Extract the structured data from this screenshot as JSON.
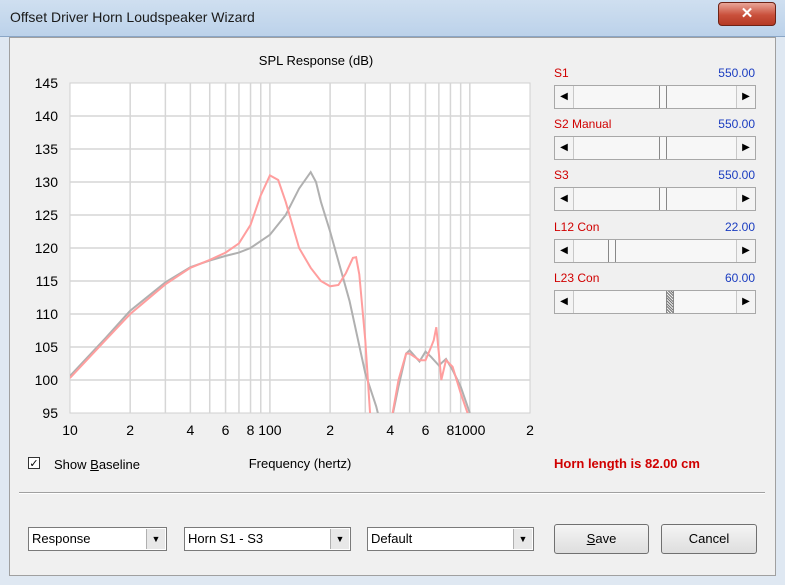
{
  "window": {
    "title": "Offset Driver Horn Loudspeaker Wizard",
    "close_glyph": "✕"
  },
  "chart": {
    "title": "SPL Response (dB)",
    "xlabel": "Frequency (hertz)",
    "y_ticks": [
      "145",
      "140",
      "135",
      "130",
      "125",
      "120",
      "115",
      "110",
      "105",
      "100",
      "95"
    ],
    "x_ticks": [
      "10",
      "2",
      "4",
      "6",
      "8",
      "100",
      "2",
      "4",
      "6",
      "8",
      "1000",
      "2"
    ]
  },
  "chart_data": {
    "type": "line",
    "title": "SPL Response (dB)",
    "xlabel": "Frequency (hertz)",
    "ylabel": "",
    "x_scale": "log",
    "xlim": [
      10,
      2000
    ],
    "ylim": [
      95,
      145
    ],
    "grid": true,
    "series": [
      {
        "color": "#ff9e9e",
        "x": [
          10,
          15,
          20,
          30,
          40,
          50,
          60,
          70,
          80,
          90,
          100,
          110,
          120,
          140,
          160,
          180,
          200,
          220,
          240,
          260,
          270,
          280,
          300,
          320,
          340,
          360,
          380,
          400,
          440,
          480,
          500,
          560,
          600,
          640,
          660,
          680,
          700,
          720,
          760,
          820,
          900,
          1000
        ],
        "y": [
          100.3,
          106,
          110,
          114.5,
          117,
          118.2,
          119.3,
          120.7,
          123.5,
          128,
          131,
          130.3,
          127,
          120,
          117,
          115,
          114.2,
          114.4,
          116.2,
          118.5,
          118.6,
          116,
          106,
          93,
          93,
          93,
          93,
          93,
          100,
          104,
          104,
          103,
          103,
          105,
          106,
          108,
          104,
          100,
          103,
          102,
          98,
          94
        ]
      },
      {
        "color": "#b0b0b0",
        "x": [
          10,
          15,
          20,
          30,
          40,
          50,
          60,
          70,
          80,
          100,
          120,
          140,
          160,
          170,
          180,
          200,
          250,
          300,
          340,
          360,
          400,
          440,
          480,
          500,
          560,
          600,
          640,
          700,
          760,
          820,
          900,
          1000
        ],
        "y": [
          100.6,
          106.3,
          110.5,
          114.8,
          117.1,
          118.1,
          118.8,
          119.3,
          120,
          122,
          125,
          129,
          131.5,
          130,
          127,
          122.5,
          112,
          101,
          96,
          93,
          93,
          99,
          104,
          104.5,
          102.8,
          104.3,
          103.5,
          102.2,
          103.2,
          101.5,
          99,
          95
        ]
      }
    ]
  },
  "baseline": {
    "checked_glyph": "✓",
    "label_pre": "Show ",
    "label_underlined": "B",
    "label_post": "aseline"
  },
  "horn_length_text": "Horn length is 82.00 cm",
  "sliders": [
    {
      "label": "S1",
      "value": "550.00",
      "position": 0.55
    },
    {
      "label": "S2  Manual",
      "value": "550.00",
      "position": 0.55
    },
    {
      "label": "S3",
      "value": "550.00",
      "position": 0.55
    },
    {
      "label": "L12  Con",
      "value": "22.00",
      "position": 0.22
    },
    {
      "label": "L23  Con",
      "value": "60.00",
      "position": 0.6
    }
  ],
  "combos": [
    {
      "value": "Response"
    },
    {
      "value": "Horn S1 - S3"
    },
    {
      "value": "Default"
    }
  ],
  "buttons": {
    "save_pre": "",
    "save_underlined": "S",
    "save_post": "ave",
    "cancel": "Cancel"
  },
  "colors": {
    "label_red": "#d00000",
    "value_blue": "#1a3cc0"
  }
}
